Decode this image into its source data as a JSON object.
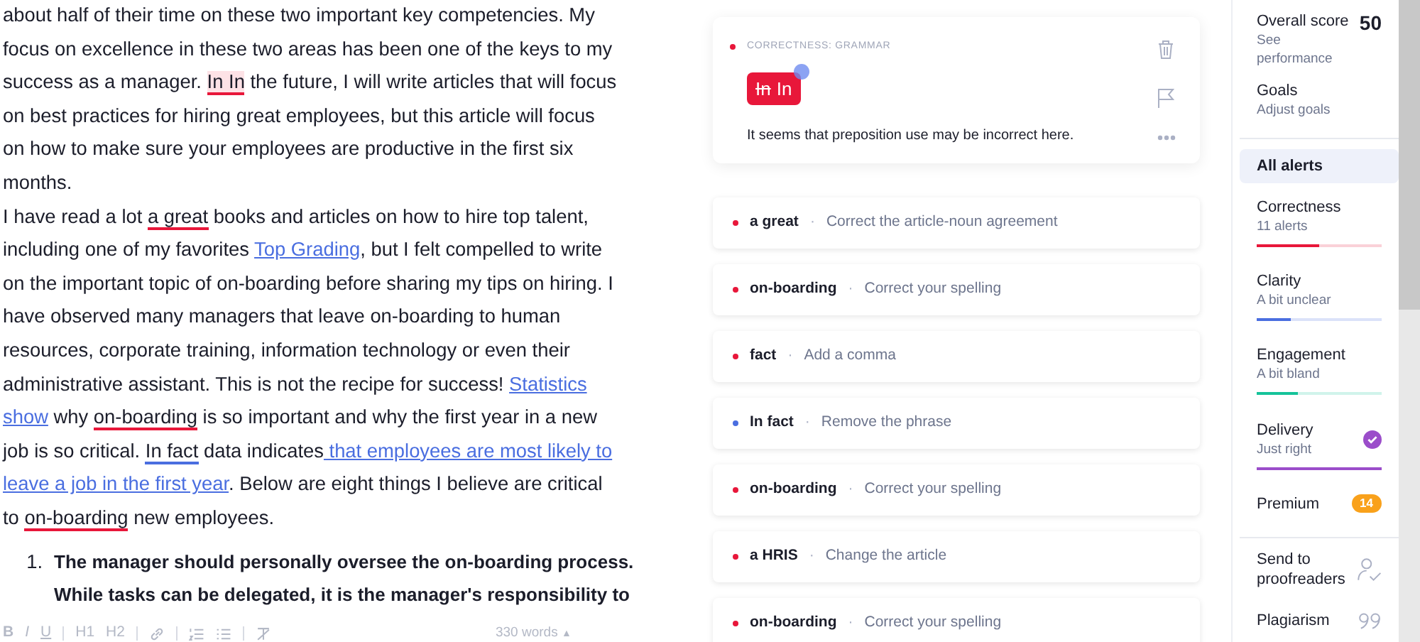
{
  "editor": {
    "paragraphs": [
      {
        "kind": "text",
        "segments": [
          {
            "kind": "plain",
            "text": "about half of their time on these two important key competencies. My focus on excellence in these two areas has been one of the keys to my success as a manager. "
          },
          {
            "kind": "highlight",
            "text": "In In",
            "color": "#e8173a"
          },
          {
            "kind": "plain",
            "text": " the future, I will write articles that will focus on best practices for hiring great employees, but this article will focus on how to make sure your employees are productive in the first six months."
          }
        ]
      },
      {
        "kind": "text",
        "segments": [
          {
            "kind": "plain",
            "text": "I have read a lot "
          },
          {
            "kind": "underline",
            "text": "a great",
            "color": "#e8173a"
          },
          {
            "kind": "plain",
            "text": " books and articles on how to hire top talent, including one of my favorites "
          },
          {
            "kind": "link",
            "text": "Top Grading"
          },
          {
            "kind": "plain",
            "text": ", but I felt compelled to write on the important topic of on-boarding before sharing my tips on hiring. I have observed many managers that leave on-boarding to human resources, corporate training, information technology or even their administrative assistant. This is not the recipe for success! "
          },
          {
            "kind": "link",
            "text": "Statistics"
          },
          {
            "kind": "space"
          },
          {
            "kind": "link",
            "text": "show"
          },
          {
            "kind": "plain",
            "text": " why "
          },
          {
            "kind": "underline",
            "text": "on-boarding",
            "color": "#e8173a"
          },
          {
            "kind": "plain",
            "text": " is so important and why the first year in a new job is so critical. "
          },
          {
            "kind": "underline",
            "text": "In fact",
            "color": "#4a6ee0"
          },
          {
            "kind": "plain",
            "text": " data indicates"
          },
          {
            "kind": "link",
            "text": " that employees are most likely to"
          },
          {
            "kind": "space"
          },
          {
            "kind": "link",
            "text": "leave a job in the first year"
          },
          {
            "kind": "plain",
            "text": ". Below are eight things I believe are critical to "
          },
          {
            "kind": "underline",
            "text": "on-boarding",
            "color": "#e8173a"
          },
          {
            "kind": "plain",
            "text": " new employees."
          }
        ]
      },
      {
        "kind": "list_item",
        "number": "1.",
        "segments": [
          {
            "kind": "plain",
            "text": "The manager should personally oversee the on-boarding process. While tasks can be delegated, it is the manager's responsibility to"
          }
        ]
      }
    ]
  },
  "toolbar": {
    "buttons": [
      {
        "kind": "text",
        "label": "B"
      },
      {
        "kind": "text",
        "label": "I"
      },
      {
        "kind": "text",
        "label": "U"
      },
      {
        "kind": "sep"
      },
      {
        "kind": "text",
        "label": "H1"
      },
      {
        "kind": "text",
        "label": "H2"
      },
      {
        "kind": "sep"
      },
      {
        "kind": "link"
      },
      {
        "kind": "sep"
      },
      {
        "kind": "ordered"
      },
      {
        "kind": "bullets"
      },
      {
        "kind": "sep"
      },
      {
        "kind": "clear"
      }
    ],
    "word_count": "330 words",
    "caret": "▲"
  },
  "active_alert": {
    "category": "CORRECTNESS: GRAMMAR",
    "color": "#e8173a",
    "removed": "In",
    "inserted": "In",
    "message": "It seems that preposition use may be incorrect here."
  },
  "alerts": [
    {
      "word": "a great",
      "sep": "·",
      "hint": "Correct the article-noun agreement",
      "color": "#e8173a"
    },
    {
      "word": "on-boarding",
      "sep": "·",
      "hint": "Correct your spelling",
      "color": "#e8173a"
    },
    {
      "word": "fact",
      "sep": "·",
      "hint": "Add a comma",
      "color": "#e8173a"
    },
    {
      "word": "In fact",
      "sep": "·",
      "hint": "Remove the phrase",
      "color": "#4a6ee0"
    },
    {
      "word": "on-boarding",
      "sep": "·",
      "hint": "Correct your spelling",
      "color": "#e8173a"
    },
    {
      "word": "a HRIS",
      "sep": "·",
      "hint": "Change the article",
      "color": "#e8173a"
    },
    {
      "word": "on-boarding",
      "sep": "·",
      "hint": "Correct your spelling",
      "color": "#e8173a"
    }
  ],
  "sidebar": {
    "items": [
      {
        "kind": "score",
        "title": "Overall score",
        "subtitle": "See performance",
        "score": "50"
      },
      {
        "kind": "link",
        "title": "Goals",
        "subtitle": "Adjust goals"
      },
      {
        "kind": "all",
        "title": "All alerts",
        "selected": true
      },
      {
        "kind": "category",
        "title": "Correctness",
        "subtitle": "11 alerts",
        "color": "#e8173a",
        "level": 0.5,
        "done": false,
        "selected": false
      },
      {
        "kind": "category",
        "title": "Clarity",
        "subtitle": "A bit unclear",
        "color": "#4a6ee0",
        "level": 0.27,
        "done": false,
        "selected": false
      },
      {
        "kind": "category",
        "title": "Engagement",
        "subtitle": "A bit bland",
        "color": "#15c39a",
        "level": 0.33,
        "done": false,
        "selected": false
      },
      {
        "kind": "category",
        "title": "Delivery",
        "subtitle": "Just right",
        "color": "#9b4dca",
        "level": 1,
        "done": true,
        "selected": false
      },
      {
        "kind": "premium",
        "title": "Premium",
        "badge": "14"
      },
      {
        "kind": "proofread",
        "title": "Send to proofreaders"
      },
      {
        "kind": "plagiarism",
        "title": "Plagiarism"
      }
    ]
  }
}
